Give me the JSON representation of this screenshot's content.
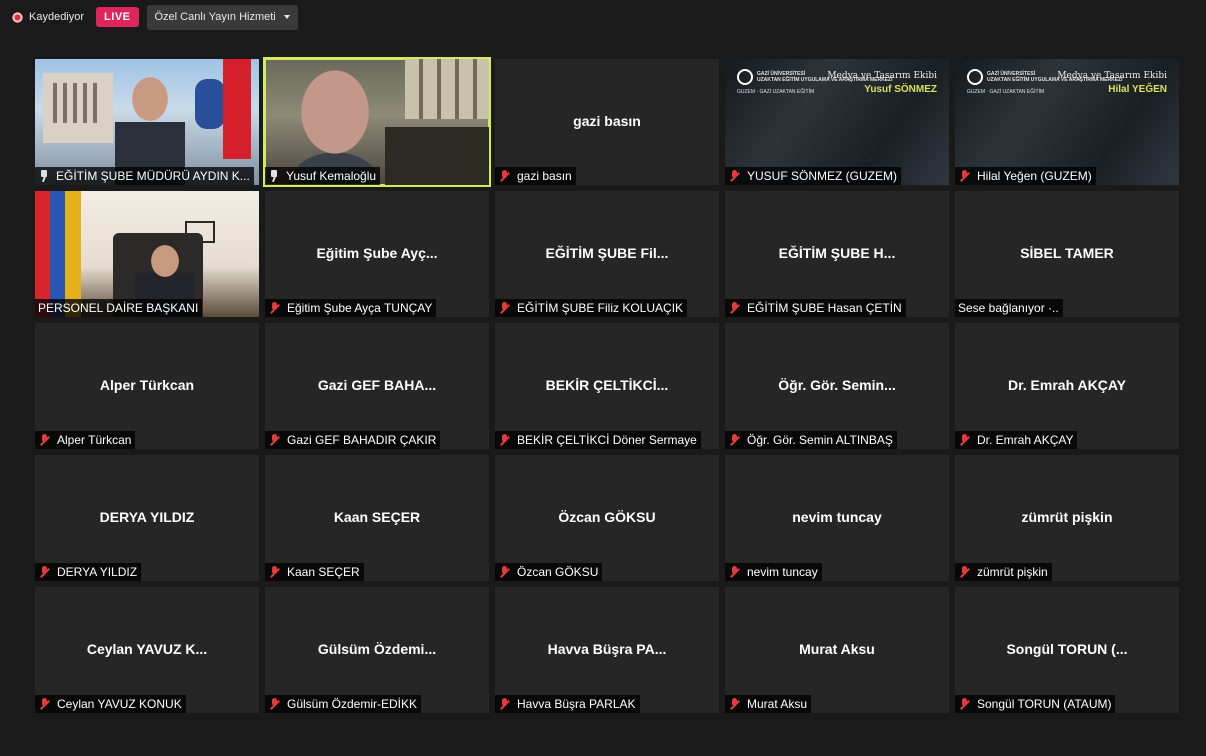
{
  "topbar": {
    "recording_label": "Kaydediyor",
    "live_label": "LIVE",
    "stream_label": "Özel Canlı Yayın Hizmeti"
  },
  "colors": {
    "active_speaker_border": "#d5ec5a",
    "live_badge": "#e0245e",
    "muted_mic": "#e23b3b"
  },
  "tiles": [
    {
      "name": "",
      "label": "EĞİTİM ŞUBE MÜDÜRÜ AYDIN K...",
      "icon": "pin-icon",
      "video": true
    },
    {
      "name": "",
      "label": "Yusuf Kemaloğlu",
      "icon": "pin-icon",
      "video": true,
      "active": true
    },
    {
      "name": "gazi basın",
      "label": "gazi basın",
      "icon": "muted-mic-icon"
    },
    {
      "name": "",
      "label": "YUSUF SÖNMEZ (GUZEM)",
      "icon": "muted-mic-icon",
      "video": true,
      "banner": {
        "org": "GAZİ ÜNİVERSİTESİ",
        "org_sub": "UZAKTAN EĞİTİM UYGULAMA VE ARAŞTIRMA MERKEZİ",
        "team": "Medya ve Tasarım Ekibi",
        "person": "Yusuf SÖNMEZ",
        "org2": "GUZEM · GAZİ UZAKTAN EĞİTİM"
      }
    },
    {
      "name": "",
      "label": "Hilal Yeğen (GUZEM)",
      "icon": "muted-mic-icon",
      "video": true,
      "banner": {
        "org": "GAZİ ÜNİVERSİTESİ",
        "org_sub": "UZAKTAN EĞİTİM UYGULAMA VE ARAŞTIRMA MERKEZİ",
        "team": "Medya ve Tasarım Ekibi",
        "person": "Hilal YEĞEN",
        "org2": "GUZEM · GAZİ UZAKTAN EĞİTİM"
      }
    },
    {
      "name": "",
      "label": "PERSONEL DAİRE BAŞKANI",
      "icon": "",
      "video": true
    },
    {
      "name": "Eğitim Şube Ayç...",
      "label": "Eğitim Şube Ayça TUNÇAY",
      "icon": "muted-mic-icon"
    },
    {
      "name": "EĞİTİM ŞUBE Fil...",
      "label": "EĞİTİM ŞUBE Filiz KOLUAÇIK",
      "icon": "muted-mic-icon"
    },
    {
      "name": "EĞİTİM ŞUBE H...",
      "label": "EĞİTİM ŞUBE Hasan ÇETİN",
      "icon": "muted-mic-icon"
    },
    {
      "name": "SİBEL TAMER",
      "label": "Sese bağlanıyor ·..",
      "icon": ""
    },
    {
      "name": "Alper Türkcan",
      "label": "Alper Türkcan",
      "icon": "muted-mic-icon"
    },
    {
      "name": "Gazi GEF BAHA...",
      "label": "Gazi GEF BAHADIR ÇAKIR",
      "icon": "muted-mic-icon"
    },
    {
      "name": "BEKİR ÇELTİKCİ...",
      "label": "BEKİR ÇELTİKCİ Döner Sermaye",
      "icon": "muted-mic-icon"
    },
    {
      "name": "Öğr. Gör. Semin...",
      "label": "Öğr. Gör. Semin ALTINBAŞ",
      "icon": "muted-mic-icon"
    },
    {
      "name": "Dr. Emrah AKÇAY",
      "label": "Dr. Emrah AKÇAY",
      "icon": "muted-mic-icon"
    },
    {
      "name": "DERYA YILDIZ",
      "label": "DERYA YILDIZ",
      "icon": "muted-mic-icon"
    },
    {
      "name": "Kaan SEÇER",
      "label": "Kaan SEÇER",
      "icon": "muted-mic-icon"
    },
    {
      "name": "Özcan GÖKSU",
      "label": "Özcan GÖKSU",
      "icon": "muted-mic-icon"
    },
    {
      "name": "nevim tuncay",
      "label": "nevim tuncay",
      "icon": "muted-mic-icon"
    },
    {
      "name": "zümrüt pişkin",
      "label": "zümrüt pişkin",
      "icon": "muted-mic-icon"
    },
    {
      "name": "Ceylan YAVUZ K...",
      "label": "Ceylan YAVUZ KONUK",
      "icon": "muted-mic-icon"
    },
    {
      "name": "Gülsüm Özdemi...",
      "label": "Gülsüm Özdemir-EDİKK",
      "icon": "muted-mic-icon"
    },
    {
      "name": "Havva Büşra PA...",
      "label": "Havva Büşra PARLAK",
      "icon": "muted-mic-icon"
    },
    {
      "name": "Murat Aksu",
      "label": "Murat Aksu",
      "icon": "muted-mic-icon"
    },
    {
      "name": "Songül TORUN (...",
      "label": "Songül TORUN (ATAUM)",
      "icon": "muted-mic-icon"
    }
  ]
}
